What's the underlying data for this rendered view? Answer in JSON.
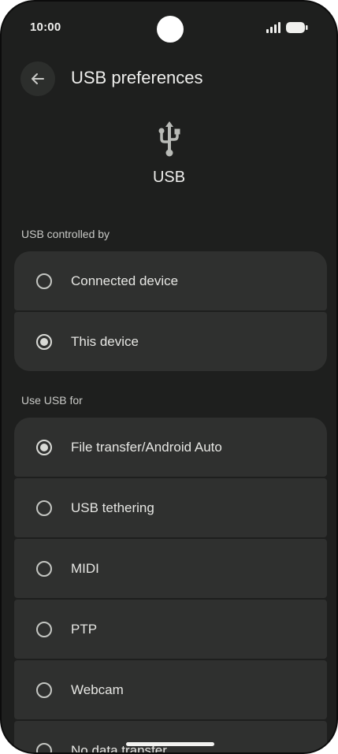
{
  "status_bar": {
    "time": "10:00",
    "icons": [
      "signal-icon",
      "battery-icon"
    ]
  },
  "app_bar": {
    "back_icon": "arrow-back-icon",
    "title": "USB preferences"
  },
  "header": {
    "icon": "usb-icon",
    "label": "USB"
  },
  "controlled_by": {
    "label": "USB controlled by",
    "options": [
      {
        "label": "Connected device",
        "checked": false
      },
      {
        "label": "This device",
        "checked": true
      }
    ]
  },
  "use_for": {
    "label": "Use USB for",
    "options": [
      {
        "label": "File transfer/Android Auto",
        "checked": true
      },
      {
        "label": "USB tethering",
        "checked": false
      },
      {
        "label": "MIDI",
        "checked": false
      },
      {
        "label": "PTP",
        "checked": false
      },
      {
        "label": "Webcam",
        "checked": false
      },
      {
        "label": "No data transfer",
        "checked": false
      }
    ]
  },
  "colors": {
    "background": "#1e1f1e",
    "surface": "#2f302f",
    "text": "#e6e6e3"
  }
}
